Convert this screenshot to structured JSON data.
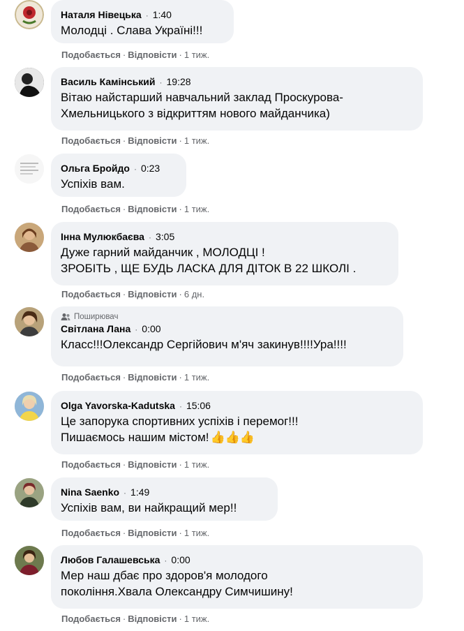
{
  "actions": {
    "like": "Подобається",
    "reply": "Відповісти",
    "dot": "·"
  },
  "badge_label": "Поширювач",
  "comments": [
    {
      "name": "Наталя Нівецька",
      "time": "1:40",
      "text": "Молодці . Слава Україні!!!",
      "age": "1 тиж."
    },
    {
      "name": "Василь Камінський",
      "time": "19:28",
      "text": "Вітаю найстарший навчальний заклад Проскурова-\nХмельницького з відкриттям нового майданчика)",
      "age": "1 тиж."
    },
    {
      "name": "Ольга Бройдо",
      "time": "0:23",
      "text": "Успіхів вам.",
      "age": "1 тиж."
    },
    {
      "name": "Інна Мулюкбаєва",
      "time": "3:05",
      "text": "Дуже гарний майданчик , МОЛОДЦІ !\nЗРОБІТЬ , ЩЕ БУДЬ ЛАСКА ДЛЯ ДІТОК В 22 ШКОЛІ .",
      "age": "6 дн."
    },
    {
      "name": "Світлана Лана",
      "time": "0:00",
      "text": "Класс!!!Олександр Сергійович м'яч закинув!!!!Ура!!!!",
      "age": "1 тиж."
    },
    {
      "name": "Olga Yavorska-Kadutska",
      "time": "15:06",
      "text": "Це запорука спортивних успіхів і перемог!!!\nПишаємось нашим містом!",
      "emoji": "👍👍👍",
      "age": "1 тиж."
    },
    {
      "name": "Nina Saenko",
      "time": "1:49",
      "text": "Успіхів вам, ви найкращий мер!!",
      "age": "1 тиж."
    },
    {
      "name": "Любов Галашевська",
      "time": "0:00",
      "text": "Мер наш дбає про здоров'я молодого\nпокоління.Хвала Олександру Симчишину!",
      "age": "1 тиж."
    }
  ],
  "colors": {
    "bubble": "#f0f2f5",
    "secondary_text": "#65676b",
    "text": "#050505"
  }
}
